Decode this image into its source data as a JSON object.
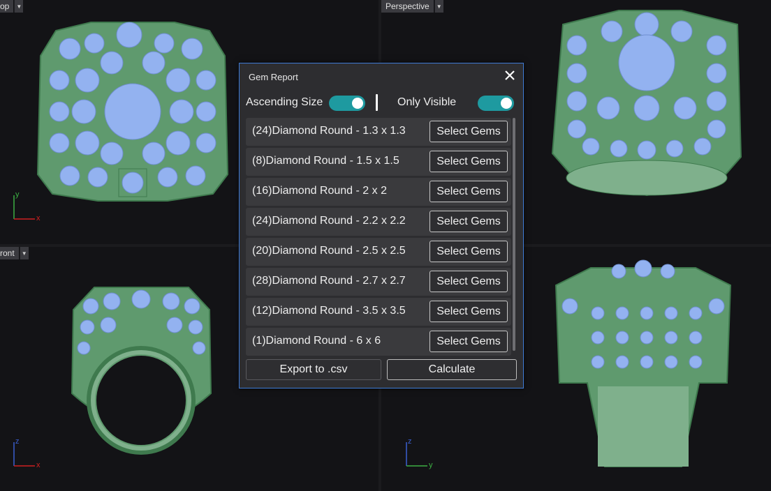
{
  "viewports": {
    "top": {
      "title": "op",
      "axis_x": "x",
      "axis_y": "y"
    },
    "perspective": {
      "title": "Perspective"
    },
    "front": {
      "title": "ront",
      "axis_x": "x",
      "axis_y": "z"
    },
    "right": {
      "title": "",
      "axis_x": "y",
      "axis_y": "z"
    }
  },
  "dialog": {
    "title": "Gem Report",
    "toggles": {
      "ascending_label": "Ascending Size",
      "ascending_on": true,
      "visible_label": "Only Visible",
      "visible_on": true
    },
    "gems": [
      {
        "label": "(24)Diamond Round - 1.3 x 1.3",
        "button": "Select Gems"
      },
      {
        "label": "(8)Diamond Round - 1.5 x 1.5",
        "button": "Select Gems"
      },
      {
        "label": "(16)Diamond Round - 2 x 2",
        "button": "Select Gems"
      },
      {
        "label": "(24)Diamond Round - 2.2 x 2.2",
        "button": "Select Gems"
      },
      {
        "label": "(20)Diamond Round - 2.5 x 2.5",
        "button": "Select Gems"
      },
      {
        "label": "(28)Diamond Round - 2.7 x 2.7",
        "button": "Select Gems"
      },
      {
        "label": "(12)Diamond Round - 3.5 x 3.5",
        "button": "Select Gems"
      },
      {
        "label": "(1)Diamond Round - 6 x 6",
        "button": "Select Gems"
      }
    ],
    "export_label": "Export to .csv",
    "calculate_label": "Calculate"
  },
  "colors": {
    "metal": "#5f9a6e",
    "gem": "#93b2f0",
    "toggle_on": "#1e9aa0",
    "dialog_border": "#3e7bd6"
  }
}
